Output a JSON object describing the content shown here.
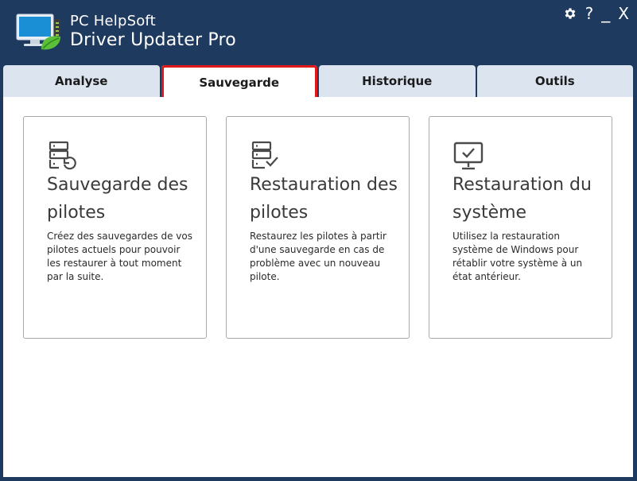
{
  "app": {
    "title_line1": "PC HelpSoft",
    "title_line2": "Driver Updater Pro",
    "logo_icon": "monitor-leaf-icon"
  },
  "window_controls": {
    "settings_icon": "gear-icon",
    "help_label": "?",
    "minimize_label": "_",
    "close_label": "X"
  },
  "tabs": [
    {
      "label": "Analyse",
      "active": false
    },
    {
      "label": "Sauvegarde",
      "active": true
    },
    {
      "label": "Historique",
      "active": false
    },
    {
      "label": "Outils",
      "active": false
    }
  ],
  "cards": [
    {
      "title": "Sauvegarde des pilotes",
      "description": "Créez des sauvegardes de vos pilotes actuels pour pouvoir les restaurer à tout moment par la suite.",
      "icon": "server-backup-icon"
    },
    {
      "title": "Restauration des pilotes",
      "description": "Restaurez les pilotes à partir d'une sauvegarde en cas de problème avec un nouveau pilote.",
      "icon": "server-check-icon"
    },
    {
      "title": "Restauration du système",
      "description": "Utilisez la restauration système de Windows pour rétablir votre système à un état antérieur.",
      "icon": "monitor-check-icon"
    }
  ],
  "colors": {
    "header_bg": "#1f3a5f",
    "tab_bg": "#dbe4ef",
    "active_tab_outline": "#e01818",
    "icon_color": "#4a4a4a"
  }
}
